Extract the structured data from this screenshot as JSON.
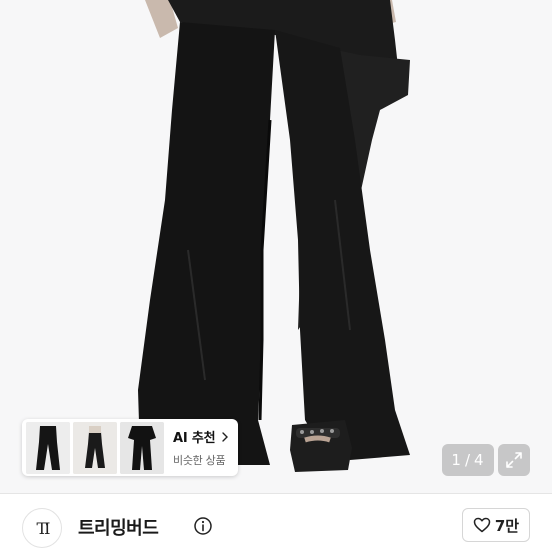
{
  "photo": {
    "description_icon": "product-photo"
  },
  "ai_recommend": {
    "title": "AI 추천",
    "subtitle": "비슷한 상품",
    "chevron_icon": "chevron-right-icon"
  },
  "pager": {
    "current": "1",
    "separator": "/",
    "total": "4"
  },
  "expand": {
    "icon": "expand-icon"
  },
  "seller": {
    "logo_text": "TI",
    "name": "트리밍버드",
    "info_icon": "info-circle-icon"
  },
  "like": {
    "icon": "heart-icon",
    "count": "7만"
  },
  "colors": {
    "overlay": "#a0a0a0",
    "text_primary": "#111111",
    "text_secondary": "#666666",
    "photo_bg": "#f7f7f8",
    "garment": "#141414"
  }
}
